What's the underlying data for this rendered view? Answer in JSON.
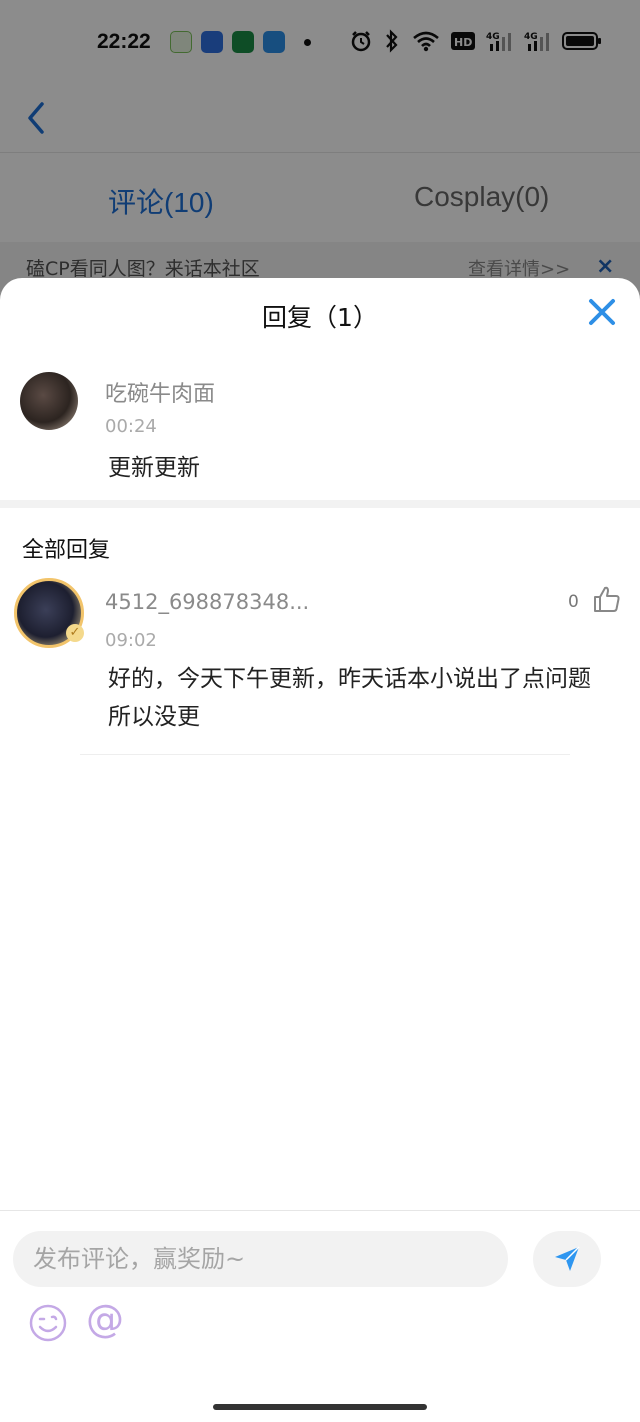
{
  "status_bar": {
    "time": "22:22",
    "notification_icons": [
      "video-app-icon",
      "baidu-icon",
      "oppo-icon",
      "browser-icon"
    ],
    "system_icons": [
      "alarm-icon",
      "bluetooth-icon",
      "wifi-icon",
      "hd-icon",
      "signal-4g-icon",
      "signal-4g-icon",
      "battery-icon"
    ],
    "hd_label": "HD2",
    "network_label": "4G"
  },
  "background": {
    "tabs": [
      {
        "label": "评论(10)",
        "active": true
      },
      {
        "label": "Cosplay(0)",
        "active": false
      }
    ],
    "banner": {
      "text": "磕CP看同人图？来话本社区",
      "link": "查看详情>>",
      "close": "×"
    }
  },
  "sheet": {
    "title": "回复（1）",
    "origin_comment": {
      "username": "吃碗牛肉面",
      "time": "00:24",
      "text": "更新更新"
    },
    "section_label": "全部回复",
    "replies": [
      {
        "username": "4512_698878348...",
        "time": "09:02",
        "text": "好的，今天下午更新，昨天话本小说出了点问题所以没更",
        "like_count": "0",
        "badge": "✓"
      }
    ]
  },
  "input_bar": {
    "placeholder": "发布评论，赢奖励~",
    "at_symbol": "@"
  },
  "colors": {
    "accent_blue": "#1e6fd6",
    "close_blue": "#2e8fe6",
    "send_blue": "#2e96f0"
  }
}
